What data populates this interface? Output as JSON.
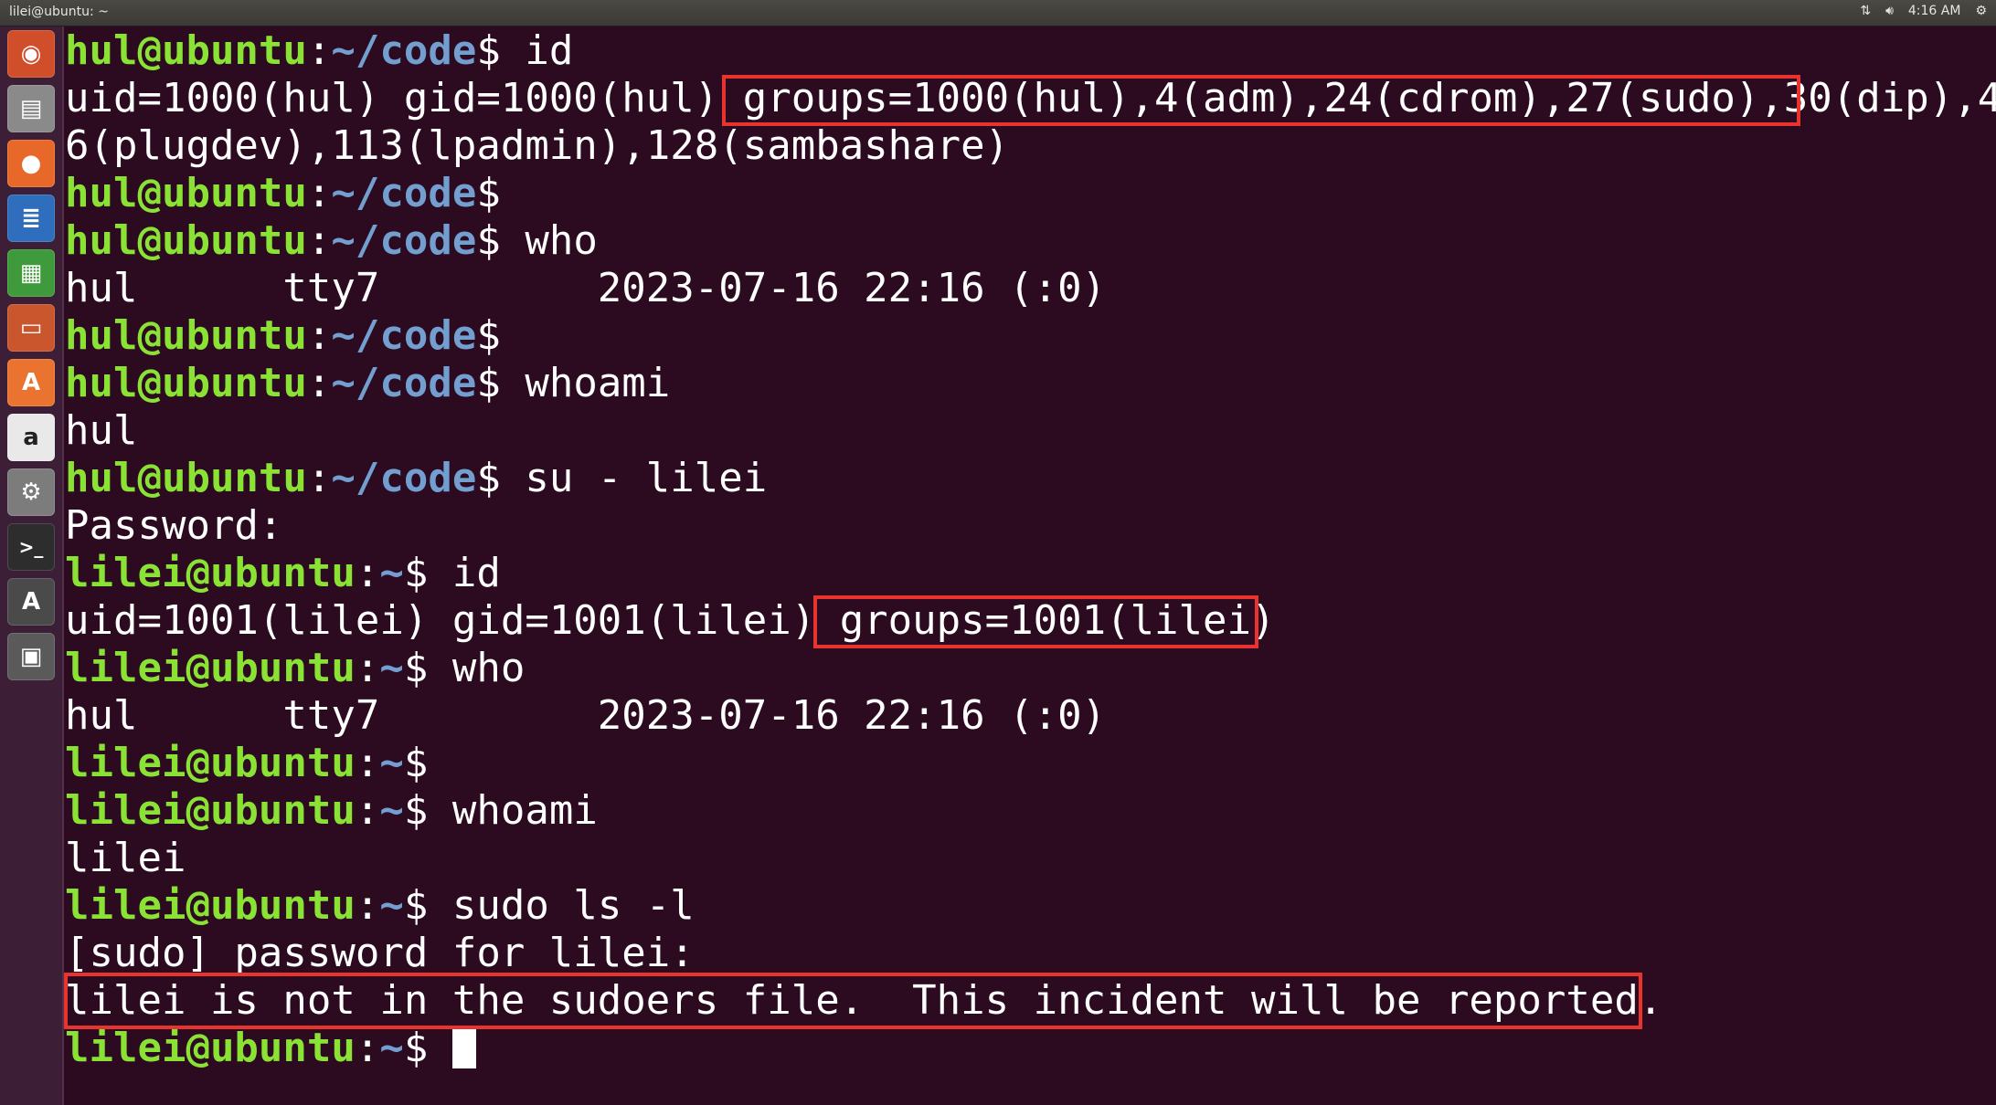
{
  "window": {
    "title": "lilei@ubuntu: ~",
    "clock": "4:16 AM",
    "status_icons": [
      "network-icon",
      "volume-icon",
      "settings-gear-icon"
    ]
  },
  "launcher": {
    "items": [
      {
        "name": "ubuntu-dash-icon",
        "glyph": "◉",
        "color": "#d14e2a"
      },
      {
        "name": "files-icon",
        "glyph": "▤",
        "color": "#8a8a8a"
      },
      {
        "name": "firefox-icon",
        "glyph": "●",
        "color": "#e8682a"
      },
      {
        "name": "writer-icon",
        "glyph": "≣",
        "color": "#2f6ebd"
      },
      {
        "name": "calc-icon",
        "glyph": "▦",
        "color": "#3e9a3a"
      },
      {
        "name": "impress-icon",
        "glyph": "▭",
        "color": "#c9562c"
      },
      {
        "name": "software-center-icon",
        "glyph": "A",
        "color": "#e9732f"
      },
      {
        "name": "amazon-icon",
        "glyph": "a",
        "color": "#e9e9e9"
      },
      {
        "name": "system-settings-icon",
        "glyph": "⚙",
        "color": "#7c7c7c"
      },
      {
        "name": "terminal-icon",
        "glyph": ">_",
        "color": "#2d2d2d"
      },
      {
        "name": "software-updater-icon",
        "glyph": "A",
        "color": "#4a4a4a"
      },
      {
        "name": "save-disk-icon",
        "glyph": "▣",
        "color": "#5a5a5a"
      }
    ]
  },
  "terminal": {
    "prompt_hul_user": "hul@ubuntu",
    "prompt_lilei_user": "lilei@ubuntu",
    "prompt_sep": ":",
    "prompt_hul_path": "~/code",
    "prompt_lilei_path": "~",
    "prompt_symbol": "$",
    "lines": {
      "l1_cmd": " id",
      "l2": "uid=1000(hul) gid=1000(hul) groups=1000(hul),4(adm),24(cdrom),27(sudo),30(dip),4",
      "l3": "6(plugdev),113(lpadmin),128(sambashare)",
      "l5_cmd": " who",
      "l6": "hul      tty7         2023-07-16 22:16 (:0)",
      "l8_cmd": " whoami",
      "l9": "hul",
      "l10_cmd": " su - lilei",
      "l11": "Password:",
      "l12_cmd": " id",
      "l13": "uid=1001(lilei) gid=1001(lilei) groups=1001(lilei)",
      "l14_cmd": " who",
      "l15": "hul      tty7         2023-07-16 22:16 (:0)",
      "l17_cmd": " whoami",
      "l18": "lilei",
      "l19_cmd": " sudo ls -l",
      "l20": "[sudo] password for lilei:",
      "l21": "lilei is not in the sudoers file.  This incident will be reported."
    }
  },
  "highlight_color": "#e8332f"
}
